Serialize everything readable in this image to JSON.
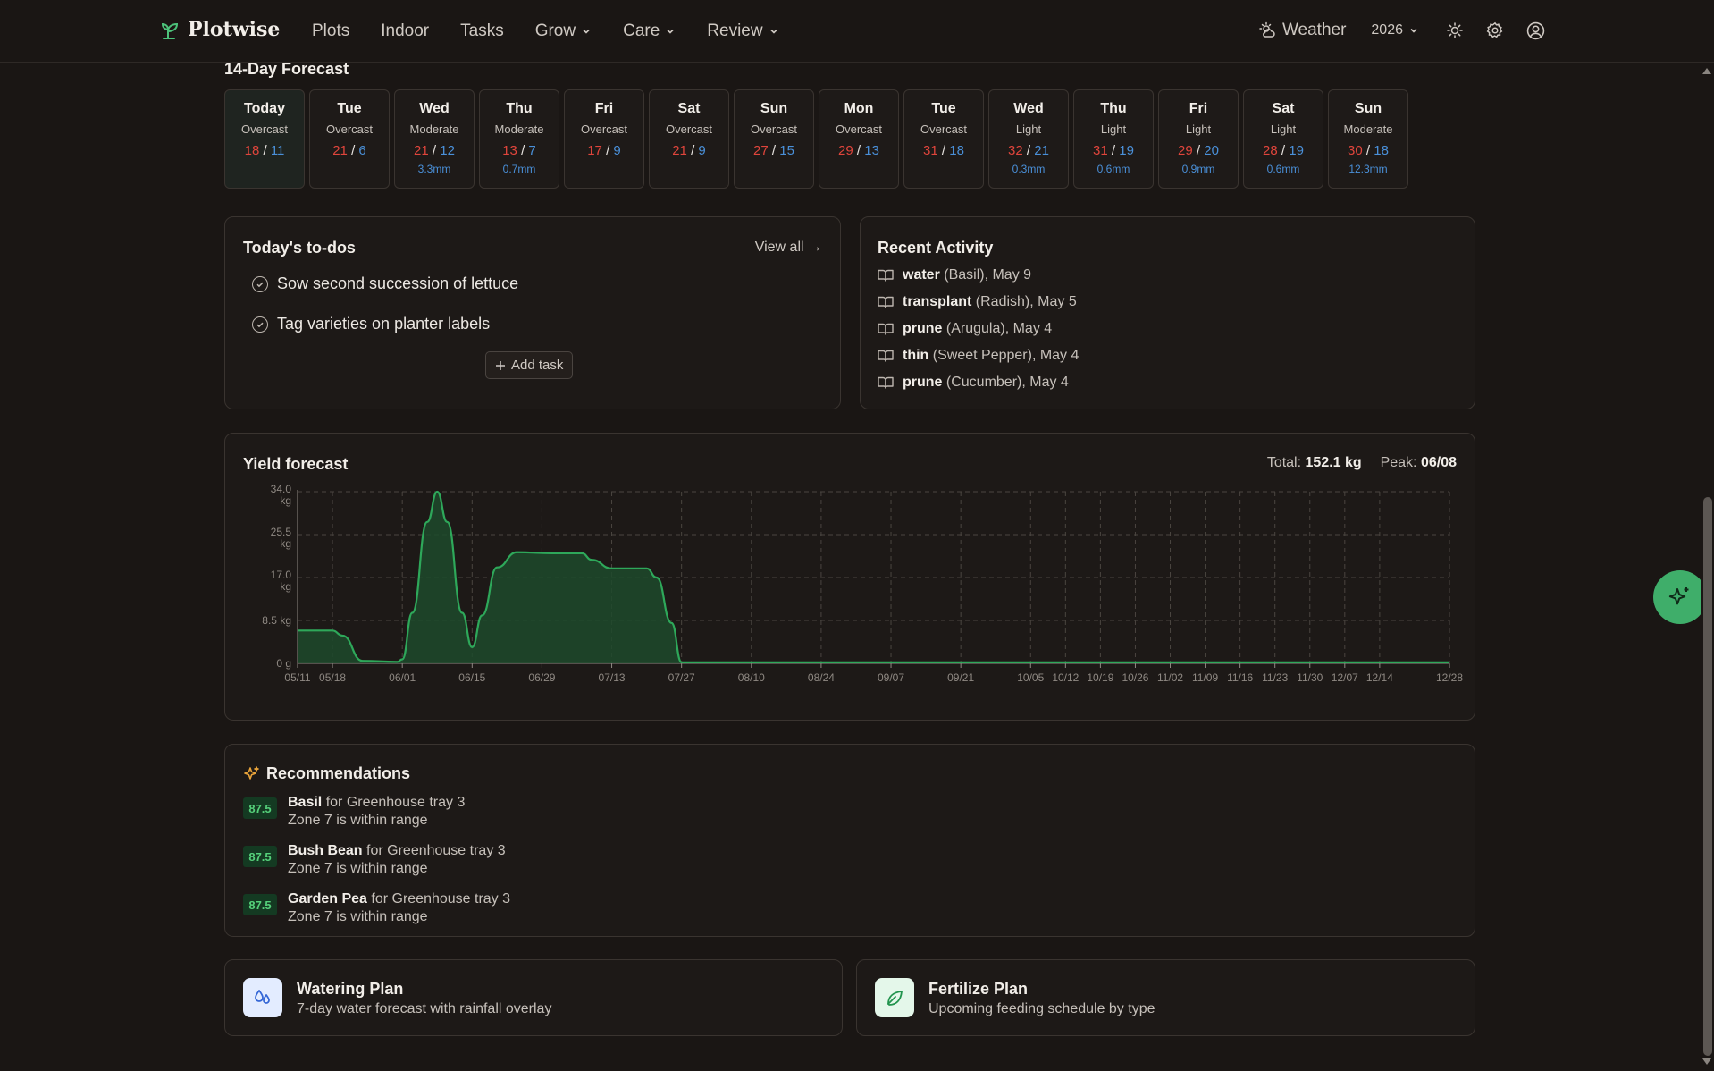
{
  "nav": {
    "brand": "Plotwise",
    "items": [
      {
        "label": "Plots",
        "dropdown": false
      },
      {
        "label": "Indoor",
        "dropdown": false
      },
      {
        "label": "Tasks",
        "dropdown": false
      },
      {
        "label": "Grow",
        "dropdown": true
      },
      {
        "label": "Care",
        "dropdown": true
      },
      {
        "label": "Review",
        "dropdown": true
      }
    ],
    "weather_label": "Weather",
    "year": "2026",
    "icons": [
      "sun-icon",
      "gear-icon",
      "user-icon"
    ]
  },
  "forecast": {
    "title": "14-Day Forecast",
    "days": [
      {
        "name": "Today",
        "cond": "Overcast",
        "hi": "18",
        "lo": "11",
        "rain": ""
      },
      {
        "name": "Tue",
        "cond": "Overcast",
        "hi": "21",
        "lo": "6",
        "rain": ""
      },
      {
        "name": "Wed",
        "cond": "Moderate",
        "hi": "21",
        "lo": "12",
        "rain": "3.3mm"
      },
      {
        "name": "Thu",
        "cond": "Moderate",
        "hi": "13",
        "lo": "7",
        "rain": "0.7mm"
      },
      {
        "name": "Fri",
        "cond": "Overcast",
        "hi": "17",
        "lo": "9",
        "rain": ""
      },
      {
        "name": "Sat",
        "cond": "Overcast",
        "hi": "21",
        "lo": "9",
        "rain": ""
      },
      {
        "name": "Sun",
        "cond": "Overcast",
        "hi": "27",
        "lo": "15",
        "rain": ""
      },
      {
        "name": "Mon",
        "cond": "Overcast",
        "hi": "29",
        "lo": "13",
        "rain": ""
      },
      {
        "name": "Tue",
        "cond": "Overcast",
        "hi": "31",
        "lo": "18",
        "rain": ""
      },
      {
        "name": "Wed",
        "cond": "Light",
        "hi": "32",
        "lo": "21",
        "rain": "0.3mm"
      },
      {
        "name": "Thu",
        "cond": "Light",
        "hi": "31",
        "lo": "19",
        "rain": "0.6mm"
      },
      {
        "name": "Fri",
        "cond": "Light",
        "hi": "29",
        "lo": "20",
        "rain": "0.9mm"
      },
      {
        "name": "Sat",
        "cond": "Light",
        "hi": "28",
        "lo": "19",
        "rain": "0.6mm"
      },
      {
        "name": "Sun",
        "cond": "Moderate",
        "hi": "30",
        "lo": "18",
        "rain": "12.3mm"
      }
    ]
  },
  "todos": {
    "title": "Today's to-dos",
    "view_all": "View all →",
    "items": [
      "Sow second succession of lettuce",
      "Tag varieties on planter labels"
    ],
    "add_label": "Add task"
  },
  "activity": {
    "title": "Recent Activity",
    "items": [
      {
        "action": "water",
        "detail": " (Basil), May 9"
      },
      {
        "action": "transplant",
        "detail": " (Radish), May 5"
      },
      {
        "action": "prune",
        "detail": " (Arugula), May 4"
      },
      {
        "action": "thin",
        "detail": " (Sweet Pepper), May 4"
      },
      {
        "action": "prune",
        "detail": " (Cucumber), May 4"
      }
    ]
  },
  "yield": {
    "title": "Yield forecast",
    "total_label": "Total:",
    "total_value": "152.1 kg",
    "peak_label": "Peak:",
    "peak_value": "06/08"
  },
  "chart_data": {
    "type": "area",
    "title": "Yield forecast",
    "ylim": [
      0,
      34.0
    ],
    "y_ticks": [
      {
        "value": 0,
        "lines": [
          "0 g"
        ]
      },
      {
        "value": 8.5,
        "lines": [
          "8.5 kg"
        ]
      },
      {
        "value": 17.0,
        "lines": [
          "17.0",
          "kg"
        ]
      },
      {
        "value": 25.5,
        "lines": [
          "25.5",
          "kg"
        ]
      },
      {
        "value": 34.0,
        "lines": [
          "34.0",
          "kg"
        ]
      }
    ],
    "x_range": [
      "2026-05-11",
      "2026-12-28"
    ],
    "x_ticks": [
      "05/11",
      "05/18",
      "06/01",
      "06/15",
      "06/29",
      "07/13",
      "07/27",
      "08/10",
      "08/24",
      "09/07",
      "09/21",
      "10/05",
      "10/12",
      "10/19",
      "10/26",
      "11/02",
      "11/09",
      "11/16",
      "11/23",
      "11/30",
      "12/07",
      "12/14",
      "12/28"
    ],
    "grid": true,
    "series": [
      {
        "x": [
          "2026-05-11",
          "2026-05-18",
          "2026-05-20",
          "2026-05-24",
          "2026-05-31",
          "2026-06-01",
          "2026-06-03",
          "2026-06-06",
          "2026-06-08",
          "2026-06-10",
          "2026-06-13",
          "2026-06-15",
          "2026-06-17",
          "2026-06-20",
          "2026-06-24",
          "2026-07-01",
          "2026-07-07",
          "2026-07-09",
          "2026-07-13",
          "2026-07-20",
          "2026-07-22",
          "2026-07-25",
          "2026-07-27",
          "2026-12-28"
        ],
        "values": [
          6.5,
          6.5,
          5.5,
          0.5,
          0.3,
          0.8,
          10.0,
          28.0,
          34.0,
          28.0,
          10.0,
          3.2,
          9.5,
          19.0,
          22.0,
          21.8,
          21.8,
          20.5,
          18.8,
          18.8,
          17.0,
          8.0,
          0.2,
          0.2
        ]
      }
    ],
    "colors": {
      "line": "#2ea85a",
      "fill": "#1d4a2c"
    }
  },
  "recommendations": {
    "title": "Recommendations",
    "items": [
      {
        "score": "87.5",
        "name": "Basil",
        "where": " for Greenhouse tray 3",
        "note": "Zone 7 is within range"
      },
      {
        "score": "87.5",
        "name": "Bush Bean",
        "where": " for Greenhouse tray 3",
        "note": "Zone 7 is within range"
      },
      {
        "score": "87.5",
        "name": "Garden Pea",
        "where": " for Greenhouse tray 3",
        "note": "Zone 7 is within range"
      }
    ]
  },
  "plans": [
    {
      "title": "Watering Plan",
      "subtitle": "7-day water forecast with rainfall overlay",
      "icon": "droplets-icon"
    },
    {
      "title": "Fertilize Plan",
      "subtitle": "Upcoming feeding schedule by type",
      "icon": "leaf-icon"
    }
  ]
}
